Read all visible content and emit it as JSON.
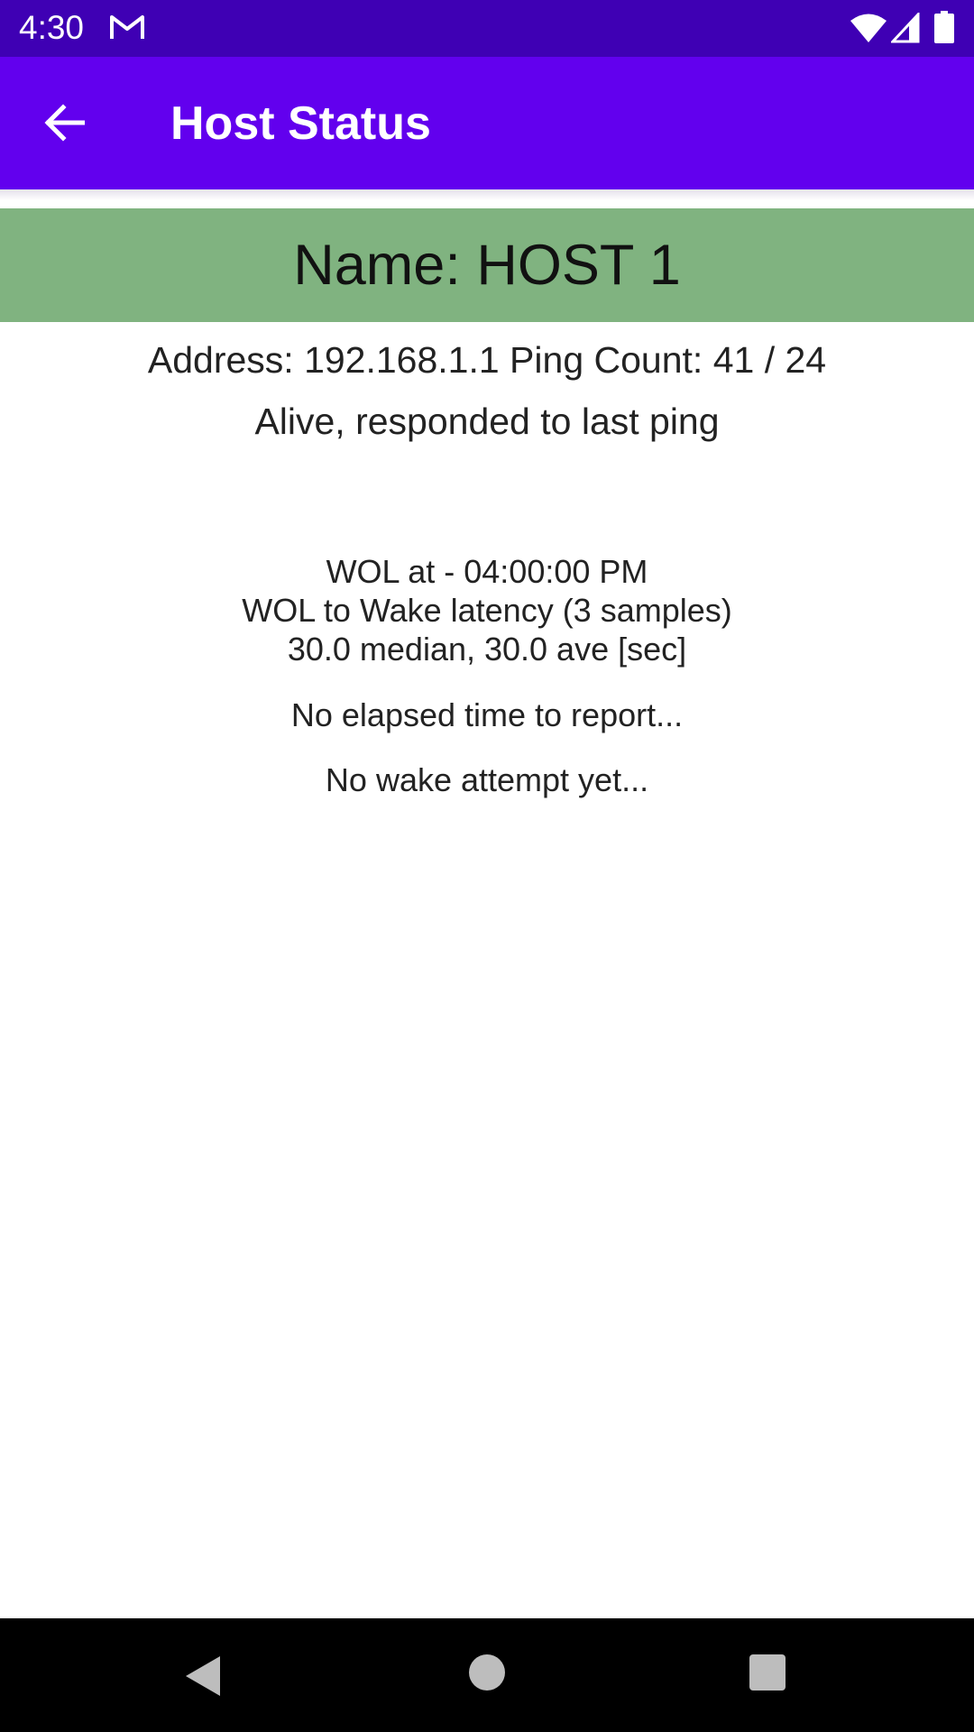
{
  "status_bar": {
    "time": "4:30",
    "background_color": "#3f00b4",
    "icons": [
      "gmail-icon",
      "wifi-icon",
      "cell-signal-icon",
      "battery-icon"
    ]
  },
  "app_bar": {
    "title": "Host Status",
    "background_color": "#6200ee",
    "back_icon": "arrow-left-icon"
  },
  "host": {
    "name_label": "Name: HOST 1",
    "banner_color": "#80b380",
    "address_line": "Address: 192.168.1.1 Ping Count: 41 / 24",
    "status_line": "Alive, responded to last ping"
  },
  "wol": {
    "at_line": "WOL at - 04:00:00 PM",
    "latency_line": "WOL to Wake latency (3 samples)",
    "stats_line": "30.0 median, 30.0 ave [sec]",
    "elapsed_line": "No elapsed time to report...",
    "wake_line": "No wake attempt yet..."
  },
  "nav_bar": {
    "icons": [
      "nav-back-icon",
      "nav-home-icon",
      "nav-recents-icon"
    ]
  }
}
